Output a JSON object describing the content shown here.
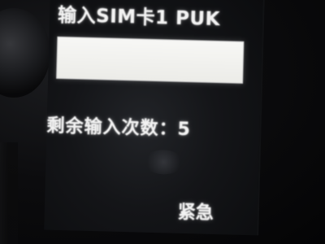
{
  "screen": {
    "title": "输入SIM卡1 PUK",
    "pin_input": {
      "value": ""
    },
    "remaining_attempts": {
      "label": "剩余输入次数：5"
    },
    "softkey_right": "紧急"
  }
}
